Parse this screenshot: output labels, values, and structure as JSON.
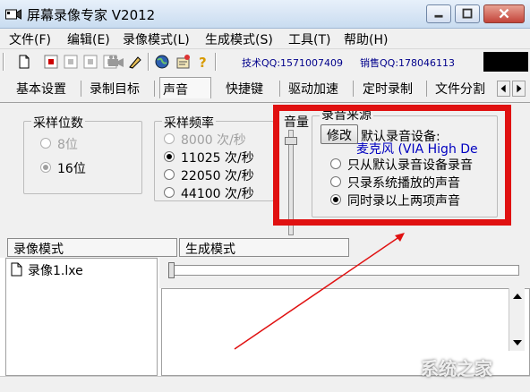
{
  "window": {
    "title": "屏幕录像专家 V2012"
  },
  "menu": [
    "文件(F)",
    "编辑(E)",
    "录像模式(L)",
    "生成模式(S)",
    "工具(T)",
    "帮助(H)"
  ],
  "toolbar": {
    "support_qq": "技术QQ:1571007409",
    "sales_qq": "销售QQ:178046113"
  },
  "tabs": [
    "基本设置",
    "录制目标",
    "声音",
    "快捷键",
    "驱动加速",
    "定时录制",
    "文件分割"
  ],
  "sound": {
    "bit_depth": {
      "label": "采样位数",
      "options": [
        "8位",
        "16位"
      ],
      "selected": "16位"
    },
    "sample_rate": {
      "label": "采样频率",
      "options": [
        "8000 次/秒",
        "11025 次/秒",
        "22050 次/秒",
        "44100 次/秒"
      ],
      "selected": "11025 次/秒"
    },
    "volume_label": "音量",
    "source": {
      "label": "录音来源",
      "modify_button": "修改",
      "default_device_label": "默认录音设备:",
      "default_device_name": "麦克风 (VIA High De",
      "options": [
        "只从默认录音设备录音",
        "只录系统播放的声音",
        "同时录以上两项声音"
      ],
      "selected": "同时录以上两项声音"
    }
  },
  "panes": {
    "left_tab": "录像模式",
    "right_tab": "生成模式",
    "files": [
      "录像1.lxe"
    ]
  },
  "watermark": "系统之家",
  "colors": {
    "highlight": "#e01111",
    "device_name": "#0000c0",
    "qq_text": "#00008b"
  }
}
